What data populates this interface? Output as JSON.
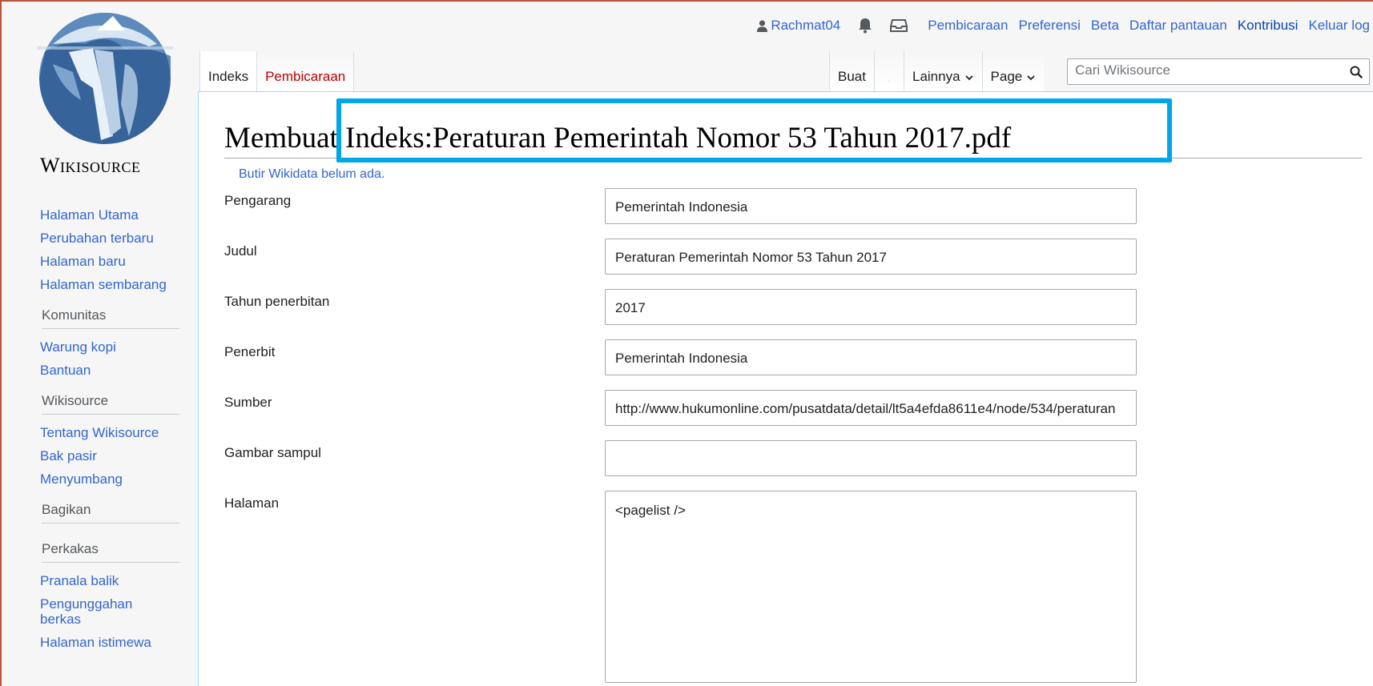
{
  "personal": {
    "username": "Rachmat04",
    "links": [
      "Pembicaraan",
      "Preferensi",
      "Beta",
      "Daftar pantauan",
      "Kontribusi",
      "Keluar log"
    ]
  },
  "logo": {
    "title": "Wikisource"
  },
  "sidebar": {
    "main_links": [
      "Halaman Utama",
      "Perubahan terbaru",
      "Halaman baru",
      "Halaman sembarang"
    ],
    "komunitas": {
      "heading": "Komunitas",
      "links": [
        "Warung kopi",
        "Bantuan"
      ]
    },
    "wikisource": {
      "heading": "Wikisource",
      "links": [
        "Tentang Wikisource",
        "Bak pasir",
        "Menyumbang"
      ]
    },
    "bagikan": {
      "heading": "Bagikan"
    },
    "perkakas": {
      "heading": "Perkakas",
      "links": [
        "Pranala balik",
        "Pengunggahan berkas",
        "Halaman istimewa"
      ]
    }
  },
  "tabs": {
    "indeks": "Indeks",
    "pembicaraan": "Pembicaraan",
    "buat": "Buat",
    "lainnya": "Lainnya",
    "page": "Page"
  },
  "search": {
    "placeholder": "Cari Wikisource"
  },
  "page": {
    "title": "Membuat Indeks:Peraturan Pemerintah Nomor 53 Tahun 2017.pdf",
    "wikidata_note": "Butir Wikidata belum ada."
  },
  "form": {
    "fields": [
      {
        "label": "Pengarang",
        "value": "Pemerintah Indonesia"
      },
      {
        "label": "Judul",
        "value": "Peraturan Pemerintah Nomor 53 Tahun 2017"
      },
      {
        "label": "Tahun penerbitan",
        "value": "2017"
      },
      {
        "label": "Penerbit",
        "value": "Pemerintah Indonesia"
      },
      {
        "label": "Sumber",
        "value": "http://www.hukumonline.com/pusatdata/detail/lt5a4efda8611e4/node/534/peraturan"
      },
      {
        "label": "Gambar sampul",
        "value": ""
      },
      {
        "label": "Halaman",
        "value": "<pagelist />"
      }
    ]
  },
  "colors": {
    "link": "#3366cc",
    "new_link": "#ba0000",
    "highlight": "#00a6e8"
  }
}
